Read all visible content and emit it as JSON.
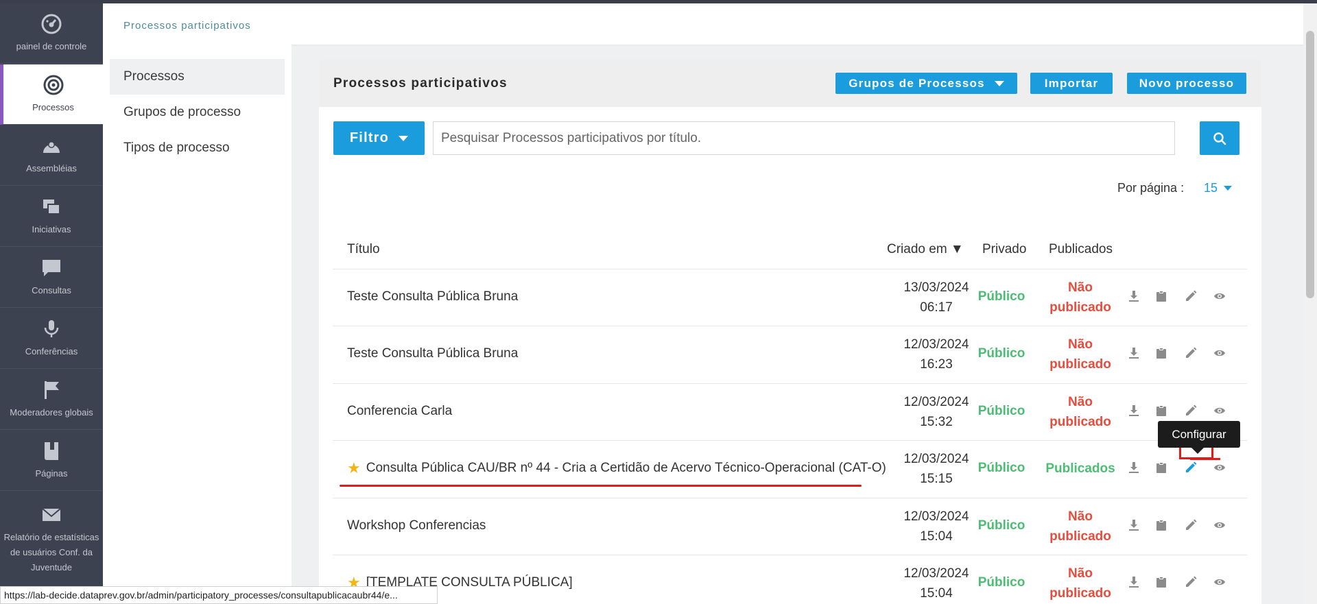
{
  "leftnav": {
    "items": [
      {
        "label": "painel de controle",
        "icon": "dashboard-icon"
      },
      {
        "label": "Processos",
        "icon": "target-icon",
        "active": true
      },
      {
        "label": "Assembléias",
        "icon": "assembly-icon"
      },
      {
        "label": "Iniciativas",
        "icon": "initiatives-icon"
      },
      {
        "label": "Consultas",
        "icon": "chat-icon"
      },
      {
        "label": "Conferências",
        "icon": "microphone-icon"
      },
      {
        "label": "Moderadores globais",
        "icon": "flag-icon"
      },
      {
        "label": "Páginas",
        "icon": "book-icon"
      },
      {
        "label": "Relatório de estatísticas de usuários Conf. da Juventude",
        "icon": "mail-icon"
      }
    ]
  },
  "header": {
    "breadcrumb": "Processos participativos"
  },
  "subnav": {
    "items": [
      {
        "label": "Processos",
        "active": true
      },
      {
        "label": "Grupos de processo"
      },
      {
        "label": "Tipos de processo"
      }
    ]
  },
  "card": {
    "title": "Processos participativos",
    "groups_button": "Grupos de Processos",
    "import_button": "Importar",
    "new_button": "Novo processo"
  },
  "filter": {
    "button": "Filtro",
    "search_placeholder": "Pesquisar Processos participativos por título."
  },
  "pagination": {
    "label": "Por página :",
    "value": "15"
  },
  "table": {
    "headers": {
      "title": "Título",
      "created": "Criado em ▼",
      "private": "Privado",
      "published": "Publicados"
    },
    "rows": [
      {
        "title": "Teste Consulta Pública Bruna",
        "date": "13/03/2024",
        "time": "06:17",
        "private": "Público",
        "pub1": "Não",
        "pub2": "publicado",
        "published": false,
        "star": false
      },
      {
        "title": "Teste Consulta Pública Bruna",
        "date": "12/03/2024",
        "time": "16:23",
        "private": "Público",
        "pub1": "Não",
        "pub2": "publicado",
        "published": false,
        "star": false
      },
      {
        "title": "Conferencia Carla",
        "date": "12/03/2024",
        "time": "15:32",
        "private": "Público",
        "pub1": "Não",
        "pub2": "publicado",
        "published": false,
        "star": false
      },
      {
        "title": "Consulta Pública CAU/BR nº 44 - Cria a Certidão de Acervo Técnico-Operacional (CAT-O)",
        "date": "12/03/2024",
        "time": "15:15",
        "private": "Público",
        "pub1": "Publicados",
        "pub2": "",
        "published": true,
        "star": true
      },
      {
        "title": "Workshop Conferencias",
        "date": "12/03/2024",
        "time": "15:04",
        "private": "Público",
        "pub1": "Não",
        "pub2": "publicado",
        "published": false,
        "star": false
      },
      {
        "title": "[TEMPLATE CONSULTA PÚBLICA]",
        "date": "12/03/2024",
        "time": "15:04",
        "private": "Público",
        "pub1": "Não",
        "pub2": "publicado",
        "published": false,
        "star": true
      }
    ]
  },
  "tooltip": {
    "text": "Configurar"
  },
  "statusbar": {
    "url": "https://lab-decide.dataprev.gov.br/admin/participatory_processes/consultapublicacaubr44/e..."
  },
  "colors": {
    "accent": "#1a9cdd",
    "sidebar": "#3d4250",
    "success": "#4dbd74",
    "danger": "#e74c3c",
    "highlight": "#e21b1b"
  }
}
